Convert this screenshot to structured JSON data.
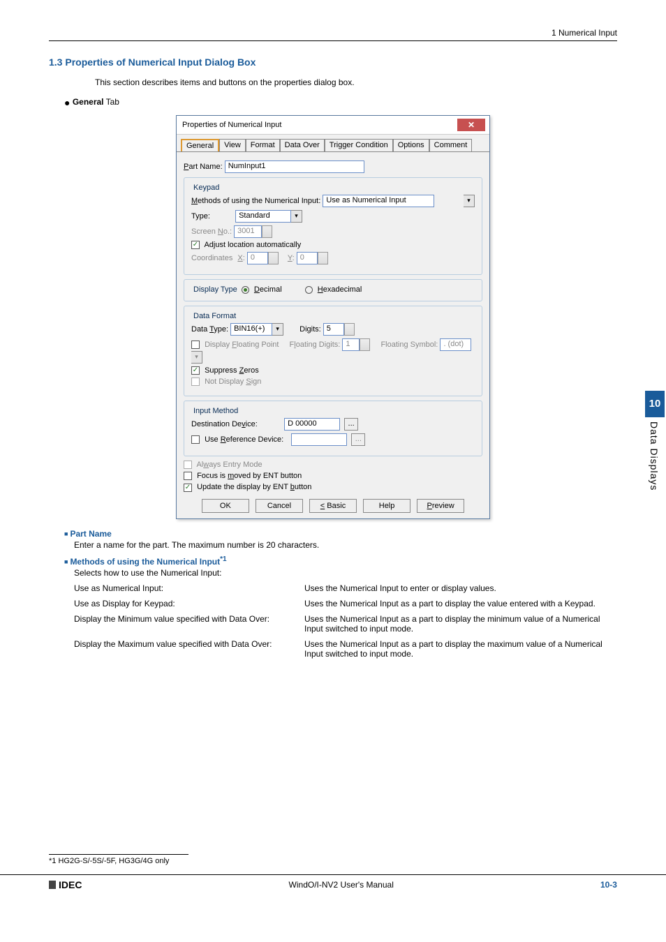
{
  "header": {
    "chapter": "1 Numerical Input"
  },
  "section": {
    "num_title": "1.3  Properties of Numerical Input Dialog Box",
    "intro": "This section describes items and buttons on the properties dialog box.",
    "general_tab_label": "General",
    "general_tab_suffix": " Tab"
  },
  "dialog": {
    "title": "Properties of Numerical Input",
    "close": "✕",
    "tabs": [
      "General",
      "View",
      "Format",
      "Data Over",
      "Trigger Condition",
      "Options",
      "Comment"
    ],
    "part_name_label": "Part Name:",
    "part_name_value": "NumInput1",
    "keypad": {
      "legend": "Keypad",
      "method_label": "Methods of using the Numerical Input:",
      "method_value": "Use as Numerical Input",
      "type_label": "Type:",
      "type_value": "Standard",
      "screen_label": "Screen No.:",
      "screen_value": "3001",
      "adjust_label": "Adjust location automatically",
      "coord_label": "Coordinates",
      "x_label": "X:",
      "x_value": "0",
      "y_label": "Y:",
      "y_value": "0"
    },
    "display_type": {
      "legend": "Display Type",
      "decimal": "Decimal",
      "hex": "Hexadecimal"
    },
    "data_format": {
      "legend": "Data Format",
      "data_type_label": "Data Type:",
      "data_type_value": "BIN16(+)",
      "digits_label": "Digits:",
      "digits_value": "5",
      "float_chk": "Display Floating Point",
      "float_digits_label": "Floating Digits:",
      "float_digits_value": "1",
      "float_symbol_label": "Floating Symbol:",
      "float_symbol_value": ". (dot)",
      "suppress": "Suppress Zeros",
      "not_sign": "Not Display Sign"
    },
    "input_method": {
      "legend": "Input Method",
      "dest_label": "Destination Device:",
      "dest_value": "D 00000",
      "use_ref": "Use Reference Device:"
    },
    "always_entry": "Always Entry Mode",
    "focus_moved": "Focus is moved by ENT button",
    "update_display": "Update the display by ENT button",
    "buttons": {
      "ok": "OK",
      "cancel": "Cancel",
      "basic": "< Basic",
      "help": "Help",
      "preview": "Preview"
    }
  },
  "content": {
    "part_name_h": "Part Name",
    "part_name_p": "Enter a name for the part. The maximum number is 20 characters.",
    "methods_h": "Methods of using the Numerical Input",
    "methods_sup": "*1",
    "methods_p": "Selects how to use the Numerical Input:",
    "rows": [
      {
        "l": "Use as Numerical Input:",
        "r": "Uses the Numerical Input to enter or display values."
      },
      {
        "l": "Use as Display for Keypad:",
        "r": "Uses the Numerical Input as a part to display the value entered with a Keypad."
      },
      {
        "l": "Display the Minimum value specified with Data Over:",
        "r": "Uses the Numerical Input as a part to display the minimum value of a Numerical Input switched to input mode."
      },
      {
        "l": "Display the Maximum value specified with Data Over:",
        "r": "Uses the Numerical Input as a part to display the maximum value of a Numerical Input switched to input mode."
      }
    ]
  },
  "side": {
    "num": "10",
    "label": "Data Displays"
  },
  "footnote": "*1  HG2G-S/-5S/-5F, HG3G/4G only",
  "footer": {
    "logo": "IDEC",
    "center": "WindO/I-NV2 User's Manual",
    "page": "10-3"
  }
}
